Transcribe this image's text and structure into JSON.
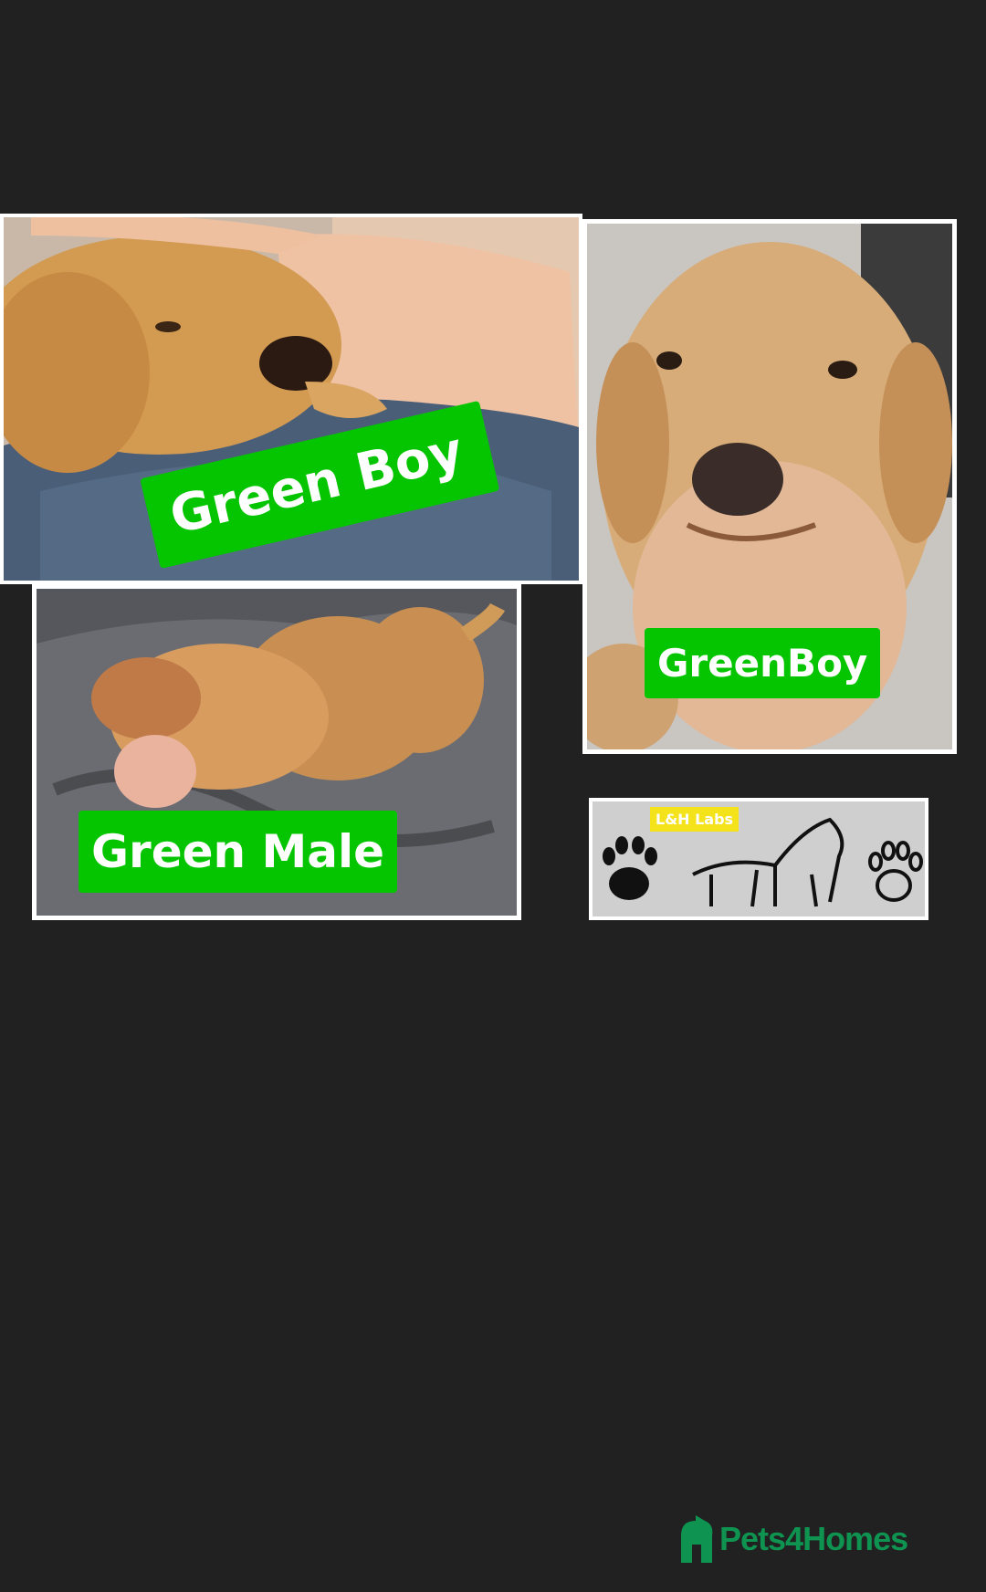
{
  "photos": [
    {
      "label": "Green Boy"
    },
    {
      "label": "GreenBoy"
    },
    {
      "label": "Green Male"
    },
    {
      "label": "L&H Labs"
    }
  ],
  "brand": {
    "name": "Pets4Homes",
    "color": "#0e9450"
  },
  "colors": {
    "background": "#212121",
    "label_green": "#05c400",
    "tag_yellow": "#f4e21a"
  }
}
